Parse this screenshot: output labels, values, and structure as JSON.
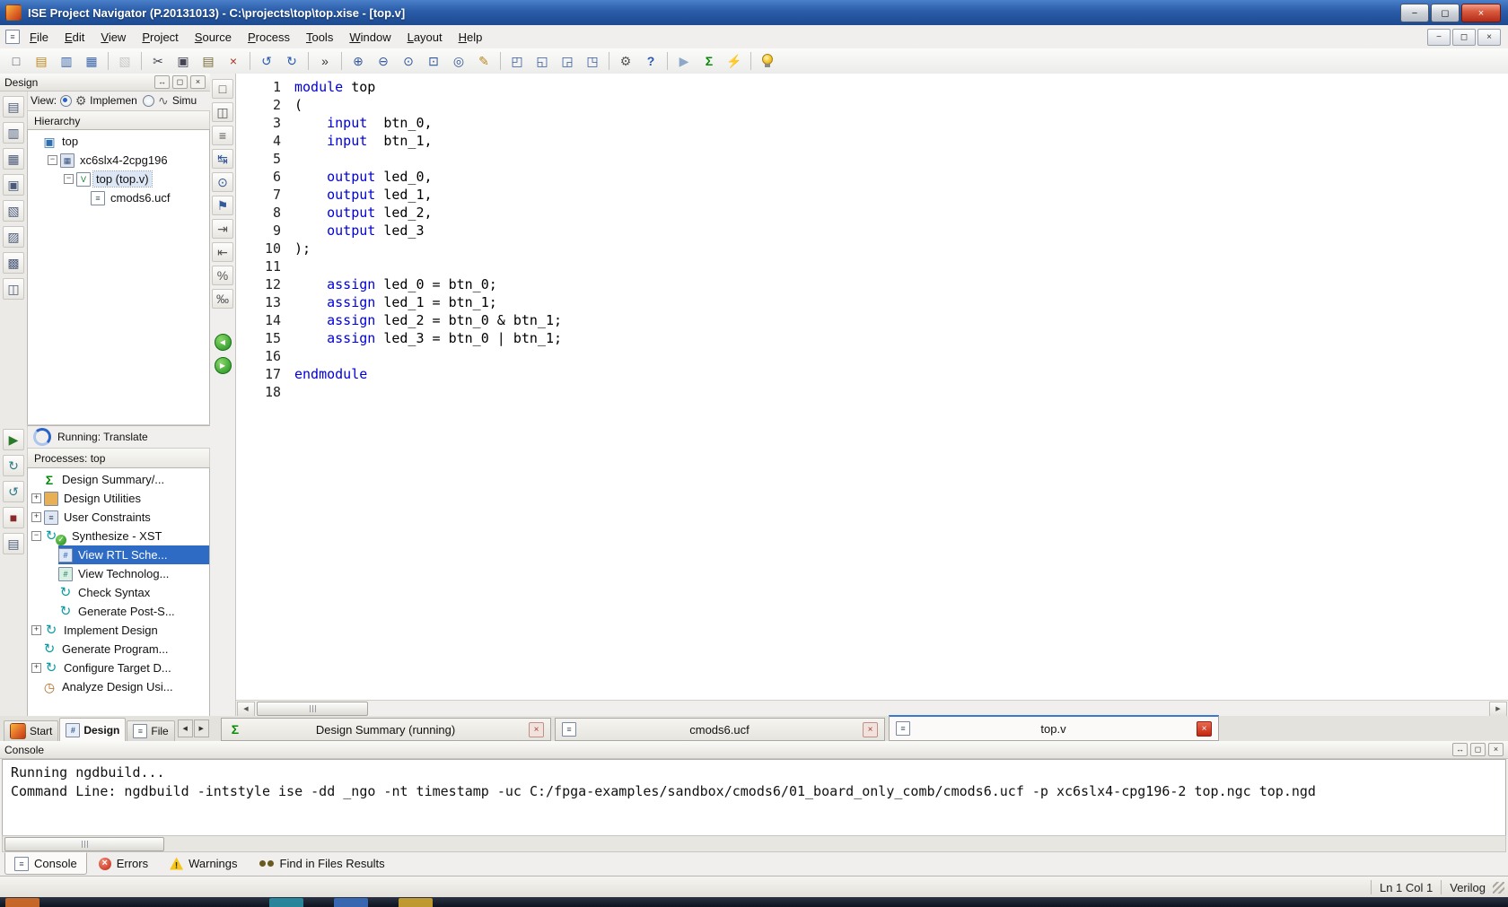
{
  "titlebar": {
    "title": "ISE Project Navigator (P.20131013) - C:\\projects\\top\\top.xise - [top.v]",
    "controls": [
      {
        "name": "minimize-window-button",
        "g": "−"
      },
      {
        "name": "restore-window-button",
        "g": "◻"
      },
      {
        "name": "close-window-button",
        "g": "×"
      }
    ]
  },
  "menubar": {
    "items": [
      "File",
      "Edit",
      "View",
      "Project",
      "Source",
      "Process",
      "Tools",
      "Window",
      "Layout",
      "Help"
    ],
    "mdi_controls": [
      {
        "name": "mdi-minimize-button",
        "g": "−"
      },
      {
        "name": "mdi-restore-button",
        "g": "◻"
      },
      {
        "name": "mdi-close-button",
        "g": "×"
      }
    ]
  },
  "panel_buttons": [
    {
      "name": "float-panel-button",
      "g": "↔"
    },
    {
      "name": "maximize-panel-button",
      "g": "◻"
    },
    {
      "name": "close-panel-button",
      "g": "×"
    }
  ],
  "toolbar": {
    "groups": [
      [
        {
          "name": "new-file-button",
          "g": "□",
          "c": "#556"
        },
        {
          "name": "open-file-button",
          "g": "▤",
          "c": "#c08a20"
        },
        {
          "name": "save-button",
          "g": "▥",
          "c": "#3a66a8"
        },
        {
          "name": "save-all-button",
          "g": "▦",
          "c": "#3a66a8"
        }
      ],
      [
        {
          "name": "print-button",
          "g": "▧",
          "c": "#888",
          "dis": true
        }
      ],
      [
        {
          "name": "cut-button",
          "g": "✂",
          "c": "#445"
        },
        {
          "name": "copy-button",
          "g": "▣",
          "c": "#445"
        },
        {
          "name": "paste-button",
          "g": "▤",
          "c": "#7a6a3a"
        },
        {
          "name": "delete-button",
          "g": "×",
          "c": "#b03020"
        }
      ],
      [
        {
          "name": "undo-button",
          "g": "↺",
          "c": "#2a58b0"
        },
        {
          "name": "redo-button",
          "g": "↻",
          "c": "#2a58b0"
        }
      ],
      [
        {
          "name": "toolbar-overflow-button",
          "g": "»",
          "c": "#333"
        }
      ],
      [
        {
          "name": "zoom-in-button",
          "g": "⊕",
          "c": "#34589a"
        },
        {
          "name": "zoom-out-button",
          "g": "⊖",
          "c": "#34589a"
        },
        {
          "name": "zoom-full-view-button",
          "g": "⊙",
          "c": "#34589a"
        },
        {
          "name": "zoom-area-button",
          "g": "⊡",
          "c": "#34589a"
        },
        {
          "name": "zoom-selection-button",
          "g": "◎",
          "c": "#34589a"
        },
        {
          "name": "language-templates-button",
          "g": "✎",
          "c": "#b8861a"
        }
      ],
      [
        {
          "name": "new-window-button",
          "g": "◰",
          "c": "#34589a"
        },
        {
          "name": "cascade-windows-button",
          "g": "◱",
          "c": "#34589a"
        },
        {
          "name": "tile-horizontal-button",
          "g": "◲",
          "c": "#34589a"
        },
        {
          "name": "tile-vertical-button",
          "g": "◳",
          "c": "#34589a"
        }
      ],
      [
        {
          "name": "settings-button",
          "g": "⚙",
          "c": "#555"
        },
        {
          "name": "context-help-button",
          "g": "?",
          "c": "#2a58b0",
          "bold": true
        }
      ],
      [
        {
          "name": "run-button",
          "g": "▶",
          "c": "#8fa8c8"
        },
        {
          "name": "design-summary-button",
          "g": "Σ",
          "c": "#0a8a0a",
          "bold": true
        },
        {
          "name": "quick-run-button",
          "g": "⚡",
          "c": "#c89a10"
        }
      ],
      [
        {
          "name": "intelligent-help-button",
          "cls": "i-bulb"
        }
      ]
    ]
  },
  "left_strip": {
    "top": [
      {
        "name": "design-view-button",
        "g": "▤",
        "c": "#4a5a7a"
      },
      {
        "name": "files-view-button",
        "g": "▥",
        "c": "#4a5a7a"
      },
      {
        "name": "libraries-view-button",
        "g": "▦",
        "c": "#4a5a7a"
      },
      {
        "name": "sources-view-button",
        "g": "▣",
        "c": "#4a5a7a"
      },
      {
        "name": "snapshots-view-button",
        "g": "▧",
        "c": "#4a5a7a"
      },
      {
        "name": "reports-view-button",
        "g": "▨",
        "c": "#4a5a7a"
      },
      {
        "name": "options-view-button",
        "g": "▩",
        "c": "#4a5a7a"
      },
      {
        "name": "summary-view-button",
        "g": "◫",
        "c": "#4a5a7a"
      }
    ],
    "bottom": [
      {
        "name": "run-process-button",
        "g": "▶",
        "c": "#2a7a2a"
      },
      {
        "name": "rerun-process-button",
        "g": "↻",
        "c": "#2a7a8a"
      },
      {
        "name": "rerun-all-button",
        "g": "↺",
        "c": "#2a7a8a"
      },
      {
        "name": "stop-process-button",
        "g": "■",
        "c": "#8a2a2a"
      },
      {
        "name": "process-properties-button",
        "g": "▤",
        "c": "#4a5a7a"
      }
    ]
  },
  "design_panel": {
    "title": "Design",
    "view": {
      "label": "View:",
      "options": [
        {
          "id": "implementation",
          "label": "Implemen",
          "icon": "gear",
          "selected": true
        },
        {
          "id": "simulation",
          "label": "Simu",
          "icon": "wave",
          "selected": false
        }
      ]
    },
    "hierarchy_label": "Hierarchy",
    "hierarchy": [
      {
        "label": "top",
        "icon": "project",
        "level": 0
      },
      {
        "label": "xc6slx4-2cpg196",
        "icon": "chip",
        "level": 1,
        "expand": "minus"
      },
      {
        "label": "top (top.v)",
        "icon": "verilog",
        "level": 2,
        "expand": "minus",
        "focused": true
      },
      {
        "label": "cmods6.ucf",
        "icon": "ucf",
        "level": 3
      }
    ],
    "status": {
      "text": "Running: Translate"
    },
    "processes_label": "Processes: top",
    "processes": [
      {
        "label": "Design Summary/...",
        "icon": "sigma",
        "level": 0
      },
      {
        "label": "Design Utilities",
        "icon": "utilities",
        "level": 0,
        "expand": "plus"
      },
      {
        "label": "User Constraints",
        "icon": "constraints",
        "level": 0,
        "expand": "plus"
      },
      {
        "label": "Synthesize - XST",
        "icon": "process",
        "level": 0,
        "expand": "minus",
        "badge": "check"
      },
      {
        "label": "View RTL Sche...",
        "icon": "rtl",
        "level": 1,
        "selected": true
      },
      {
        "label": "View Technolog...",
        "icon": "tech",
        "level": 1
      },
      {
        "label": "Check Syntax",
        "icon": "process",
        "level": 1
      },
      {
        "label": "Generate Post-S...",
        "icon": "process",
        "level": 1
      },
      {
        "label": "Implement Design",
        "icon": "process",
        "level": 0,
        "expand": "plus"
      },
      {
        "label": "Generate Program...",
        "icon": "process",
        "level": 0
      },
      {
        "label": "Configure Target D...",
        "icon": "config",
        "level": 0,
        "expand": "plus"
      },
      {
        "label": "Analyze Design Usi...",
        "icon": "analyze",
        "level": 0
      }
    ]
  },
  "editor_toolbar": {
    "icons": [
      {
        "name": "select-tool-button",
        "g": "□",
        "c": "#555"
      },
      {
        "name": "column-select-button",
        "g": "◫",
        "c": "#555"
      },
      {
        "name": "toggle-ruler-button",
        "g": "≡",
        "c": "#555"
      },
      {
        "name": "goto-line-button",
        "g": "↹",
        "c": "#345a9a"
      },
      {
        "name": "find-button",
        "g": "⊙",
        "c": "#345a9a"
      },
      {
        "name": "bookmark-button",
        "g": "⚑",
        "c": "#345a9a"
      },
      {
        "name": "indent-button",
        "g": "⇥",
        "c": "#555"
      },
      {
        "name": "outdent-button",
        "g": "⇤",
        "c": "#555"
      },
      {
        "name": "comment-button",
        "g": "%",
        "c": "#555"
      },
      {
        "name": "uncomment-button",
        "g": "‰",
        "c": "#555"
      }
    ],
    "nav": [
      {
        "name": "nav-back-button",
        "g": "◀"
      },
      {
        "name": "nav-forward-button",
        "g": "▶"
      }
    ]
  },
  "editor": {
    "lines": [
      {
        "n": "1",
        "t": [
          [
            "module",
            "k"
          ],
          [
            " top"
          ]
        ]
      },
      {
        "n": "2",
        "t": [
          [
            "("
          ]
        ]
      },
      {
        "n": "3",
        "t": [
          [
            "    "
          ],
          [
            "input",
            "k"
          ],
          [
            "  btn_0,"
          ]
        ]
      },
      {
        "n": "4",
        "t": [
          [
            "    "
          ],
          [
            "input",
            "k"
          ],
          [
            "  btn_1,"
          ]
        ]
      },
      {
        "n": "5",
        "t": []
      },
      {
        "n": "6",
        "t": [
          [
            "    "
          ],
          [
            "output",
            "k"
          ],
          [
            " led_0,"
          ]
        ]
      },
      {
        "n": "7",
        "t": [
          [
            "    "
          ],
          [
            "output",
            "k"
          ],
          [
            " led_1,"
          ]
        ]
      },
      {
        "n": "8",
        "t": [
          [
            "    "
          ],
          [
            "output",
            "k"
          ],
          [
            " led_2,"
          ]
        ]
      },
      {
        "n": "9",
        "t": [
          [
            "    "
          ],
          [
            "output",
            "k"
          ],
          [
            " led_3"
          ]
        ]
      },
      {
        "n": "10",
        "t": [
          [
            ");"
          ]
        ]
      },
      {
        "n": "11",
        "t": []
      },
      {
        "n": "12",
        "t": [
          [
            "    "
          ],
          [
            "assign",
            "k"
          ],
          [
            " led_0 = btn_0;"
          ]
        ]
      },
      {
        "n": "13",
        "t": [
          [
            "    "
          ],
          [
            "assign",
            "k"
          ],
          [
            " led_1 = btn_1;"
          ]
        ]
      },
      {
        "n": "14",
        "t": [
          [
            "    "
          ],
          [
            "assign",
            "k"
          ],
          [
            " led_2 = btn_0 & btn_1;"
          ]
        ]
      },
      {
        "n": "15",
        "t": [
          [
            "    "
          ],
          [
            "assign",
            "k"
          ],
          [
            " led_3 = btn_0 | btn_1;"
          ]
        ]
      },
      {
        "n": "16",
        "t": []
      },
      {
        "n": "17",
        "t": [
          [
            "endmodule",
            "k"
          ]
        ]
      },
      {
        "n": "18",
        "t": []
      }
    ]
  },
  "panel_tabs": {
    "items": [
      {
        "id": "start",
        "label": "Start",
        "icon": "logo"
      },
      {
        "id": "design",
        "label": "Design",
        "icon": "design-tab",
        "selected": true
      },
      {
        "id": "files",
        "label": "File",
        "icon": "doc",
        "clip": true
      }
    ]
  },
  "doc_tabs": [
    {
      "id": "design-summary",
      "label": "Design Summary (running)",
      "icon": "sigma"
    },
    {
      "id": "cmods6-ucf",
      "label": "cmods6.ucf",
      "icon": "doc"
    },
    {
      "id": "top-v",
      "label": "top.v",
      "icon": "doc",
      "active": true
    }
  ],
  "console": {
    "title": "Console",
    "lines": [
      "Running ngdbuild...",
      "Command Line: ngdbuild -intstyle ise -dd _ngo -nt timestamp -uc C:/fpga-examples/sandbox/cmods6/01_board_only_comb/cmods6.ucf -p xc6slx4-cpg196-2 top.ngc top.ngd"
    ]
  },
  "console_tabs": [
    {
      "id": "console",
      "label": "Console",
      "icon": "console-i",
      "selected": true
    },
    {
      "id": "errors",
      "label": "Errors",
      "icon": "error"
    },
    {
      "id": "warnings",
      "label": "Warnings",
      "icon": "warning"
    },
    {
      "id": "find-in-files",
      "label": "Find in Files Results",
      "icon": "binoculars"
    }
  ],
  "statusbar": {
    "position": "Ln 1 Col 1",
    "language": "Verilog"
  },
  "taskbar": {
    "items": [
      {
        "name": "taskbar-app-1",
        "color": "#d06a28"
      },
      {
        "name": "taskbar-app-2",
        "color": "#2a8aa0"
      },
      {
        "name": "taskbar-app-3",
        "color": "#3a6ab8"
      },
      {
        "name": "taskbar-app-4",
        "color": "#c8a030"
      }
    ]
  },
  "colors": {
    "titlebar_blue": "#2a5ca8",
    "selection_blue": "#2e6bc4",
    "keyword_blue": "#0000d8",
    "success_green": "#1e8a1e",
    "error_red": "#c22810",
    "warning_yellow": "#f5c518",
    "active_tab_accent": "#3a78d0"
  },
  "icons": {
    "project": {
      "g": "▣",
      "c": "#2f6fb0"
    },
    "chip": {
      "box": 1,
      "g": "▦",
      "c": "#33507a",
      "bg": "#dfe6f2"
    },
    "verilog": {
      "box": 1,
      "g": "V",
      "c": "#0a7a2a",
      "bg": "#ffffff"
    },
    "ucf": {
      "box": 1,
      "g": "≡",
      "c": "#445566",
      "bg": "#ffffff"
    },
    "sigma": {
      "g": "Σ",
      "c": "#0a8a0a",
      "bold": 1
    },
    "utilities": {
      "box": 1,
      "g": "",
      "bg": "#e8b055"
    },
    "constraints": {
      "box": 1,
      "g": "≡",
      "c": "#334455",
      "bg": "#dfe7f5"
    },
    "process": {
      "g": "↻",
      "c": "#0a9aa0",
      "fs": 15
    },
    "rtl": {
      "box": 1,
      "g": "#",
      "c": "#2255aa",
      "bg": "#dce8fa"
    },
    "tech": {
      "box": 1,
      "g": "#",
      "c": "#22795a",
      "bg": "#d8f0e4"
    },
    "config": {
      "g": "↻",
      "c": "#0a9aa0",
      "fs": 15
    },
    "analyze": {
      "g": "◷",
      "c": "#b06a20",
      "fs": 14
    },
    "gear": {
      "g": "⚙",
      "c": "#555555"
    },
    "wave": {
      "g": "∿",
      "c": "#666666"
    },
    "doc": {
      "box": 1,
      "g": "≡",
      "c": "#445566",
      "bg": "#ffffff"
    },
    "console-i": {
      "box": 1,
      "g": "≡",
      "c": "#445566",
      "bg": "#ffffff"
    },
    "design-tab": {
      "box": 1,
      "g": "#",
      "c": "#345a8a",
      "bg": "#e8eef8"
    },
    "logo": {
      "cls": "i-logo"
    },
    "error": {
      "cls": "i-err"
    },
    "warning": {
      "cls": "i-warn"
    },
    "binoculars": {
      "cls": "i-binoc"
    },
    "spinner": {
      "cls": "i-spin"
    },
    "mdoc": {
      "g": "≡"
    },
    "close": {
      "g": "×"
    },
    "arrow_left": {
      "g": "◀"
    },
    "arrow_right": {
      "g": "▶"
    }
  }
}
